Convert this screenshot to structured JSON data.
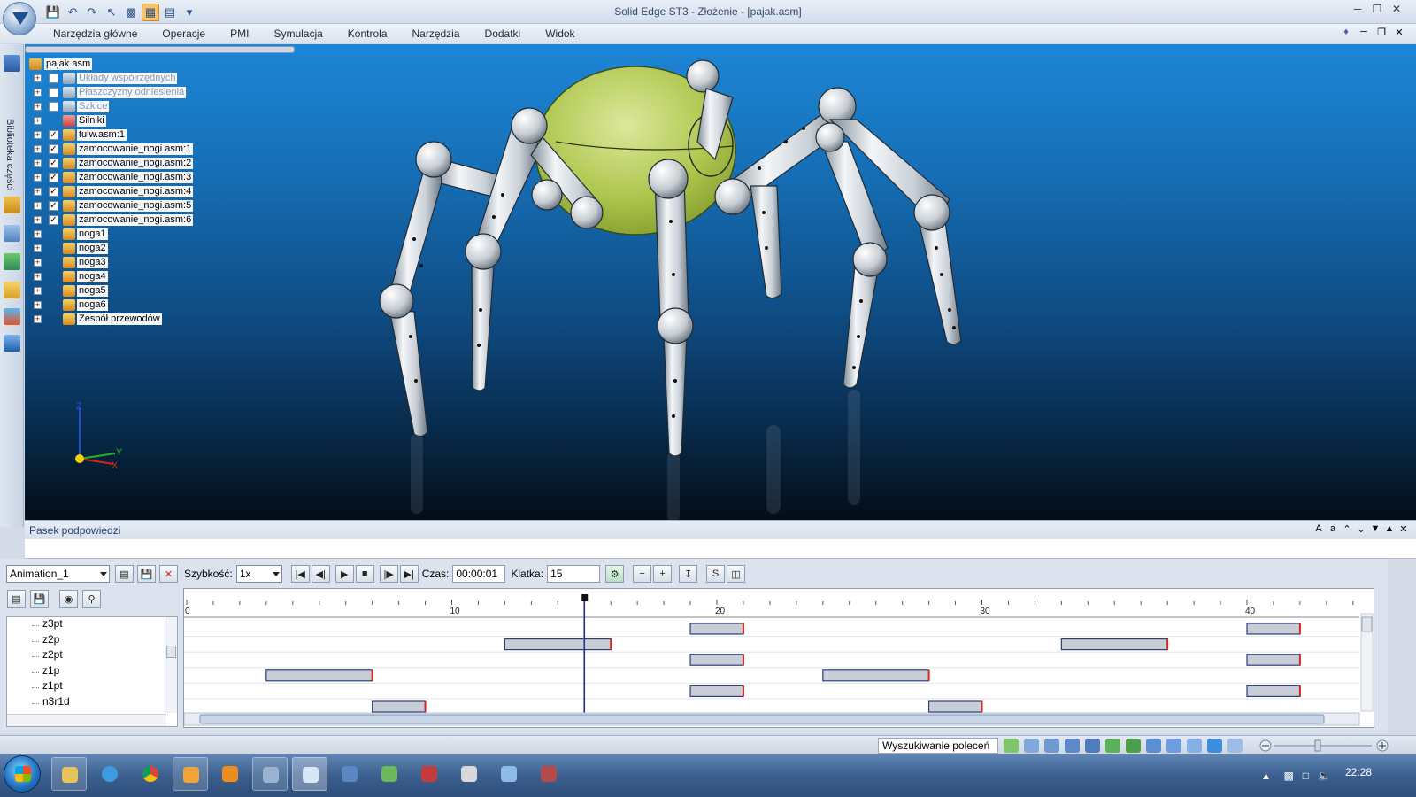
{
  "window": {
    "title": "Solid Edge ST3 - Złożenie - [pajak.asm]"
  },
  "menu": {
    "items": [
      "Narzędzia główne",
      "Operacje",
      "PMI",
      "Symulacja",
      "Kontrola",
      "Narzędzia",
      "Dodatki",
      "Widok"
    ]
  },
  "left_panel": {
    "library_label": "Biblioteka części"
  },
  "tree": {
    "root": "pajak.asm",
    "items": [
      {
        "label": "Układy współrzędnych",
        "checked": false,
        "dim": true
      },
      {
        "label": "Płaszczyzny odniesienia",
        "checked": false,
        "dim": true
      },
      {
        "label": "Szkice",
        "checked": false,
        "dim": true
      },
      {
        "label": "Silniki",
        "checked": null,
        "dim": false
      },
      {
        "label": "tulw.asm:1",
        "checked": true,
        "dim": false
      },
      {
        "label": "zamocowanie_nogi.asm:1",
        "checked": true,
        "dim": false
      },
      {
        "label": "zamocowanie_nogi.asm:2",
        "checked": true,
        "dim": false
      },
      {
        "label": "zamocowanie_nogi.asm:3",
        "checked": true,
        "dim": false
      },
      {
        "label": "zamocowanie_nogi.asm:4",
        "checked": true,
        "dim": false
      },
      {
        "label": "zamocowanie_nogi.asm:5",
        "checked": true,
        "dim": false
      },
      {
        "label": "zamocowanie_nogi.asm:6",
        "checked": true,
        "dim": false
      },
      {
        "label": "noga1",
        "checked": null,
        "dim": false
      },
      {
        "label": "noga2",
        "checked": null,
        "dim": false
      },
      {
        "label": "noga3",
        "checked": null,
        "dim": false
      },
      {
        "label": "noga4",
        "checked": null,
        "dim": false
      },
      {
        "label": "noga5",
        "checked": null,
        "dim": false
      },
      {
        "label": "noga6",
        "checked": null,
        "dim": false
      },
      {
        "label": "Zespół przewodów",
        "checked": null,
        "dim": false
      }
    ]
  },
  "triad": {
    "x": "X",
    "y": "Y",
    "z": "Z"
  },
  "hint_bar": {
    "title": "Pasek podpowiedzi"
  },
  "animation": {
    "name": "Animation_1",
    "speed_label": "Szybkość:",
    "speed_value": "1x",
    "time_label": "Czas:",
    "time_value": "00:00:01",
    "frame_label": "Klatka:",
    "frame_value": "15",
    "timeline_ticks": [
      "0",
      "10",
      "20",
      "30",
      "40"
    ],
    "current_frame": 15,
    "tracks": [
      {
        "name": "z3pt",
        "bars": [
          [
            19,
            21
          ],
          [
            40,
            42
          ]
        ]
      },
      {
        "name": "z2p",
        "bars": [
          [
            12,
            16
          ],
          [
            33,
            37
          ]
        ]
      },
      {
        "name": "z2pt",
        "bars": [
          [
            19,
            21
          ],
          [
            40,
            42
          ]
        ]
      },
      {
        "name": "z1p",
        "bars": [
          [
            3,
            7
          ],
          [
            24,
            28
          ]
        ]
      },
      {
        "name": "z1pt",
        "bars": [
          [
            19,
            21
          ],
          [
            40,
            42
          ]
        ]
      },
      {
        "name": "n3r1d",
        "bars": [
          [
            7,
            9
          ],
          [
            28,
            30
          ]
        ]
      }
    ]
  },
  "status": {
    "command_search": "Wyszukiwanie poleceń"
  },
  "taskbar": {
    "clock": "22:28"
  }
}
